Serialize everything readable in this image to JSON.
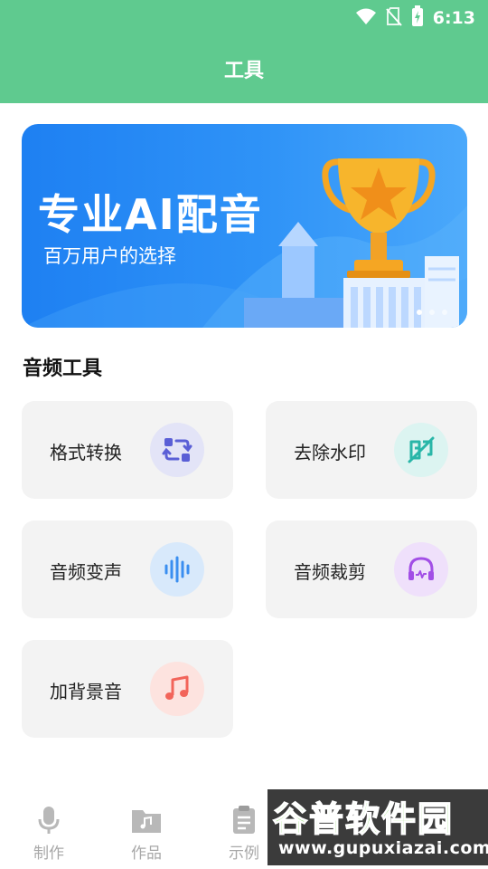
{
  "status_bar": {
    "time": "6:13"
  },
  "app_bar": {
    "title": "工具"
  },
  "banner": {
    "title": "专业AI配音",
    "subtitle": "百万用户的选择"
  },
  "section": {
    "title": "音频工具"
  },
  "tools": [
    {
      "label": "格式转换",
      "icon": "convert-icon",
      "color": "#5a5fd6",
      "bg": "#e3e4f7"
    },
    {
      "label": "去除水印",
      "icon": "watermark-remove-icon",
      "color": "#29b6a8",
      "bg": "#dcf4f1"
    },
    {
      "label": "音频变声",
      "icon": "voice-wave-icon",
      "color": "#3a8ef0",
      "bg": "#d8e9fb"
    },
    {
      "label": "音频裁剪",
      "icon": "headphones-icon",
      "color": "#a24ee6",
      "bg": "#efe0fb"
    },
    {
      "label": "加背景音",
      "icon": "music-note-icon",
      "color": "#f2645a",
      "bg": "#fde3df"
    }
  ],
  "bottom_nav": [
    {
      "label": "制作",
      "icon": "microphone-icon"
    },
    {
      "label": "作品",
      "icon": "folder-music-icon"
    },
    {
      "label": "示例",
      "icon": "clipboard-icon"
    }
  ],
  "watermark": {
    "name": "谷普软件园",
    "url": "www.gupuxiazai.com"
  }
}
